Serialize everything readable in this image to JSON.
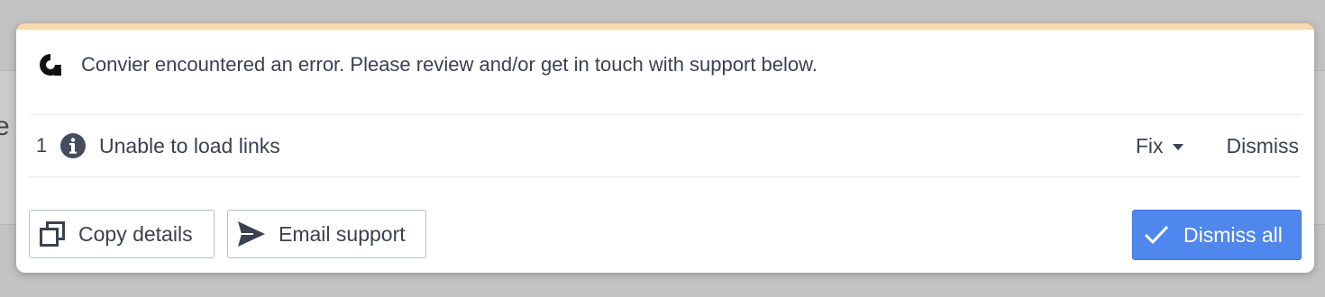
{
  "background": {
    "peek_text": "e"
  },
  "dialog": {
    "accent_color": "#fbd9ae",
    "logo_icon": "convier-logo-icon",
    "message": "Convier encountered an error. Please review and/or get in touch with support below."
  },
  "errors": [
    {
      "count": "1",
      "icon": "info-icon",
      "text": "Unable to load links",
      "fix_label": "Fix",
      "dismiss_label": "Dismiss"
    }
  ],
  "footer": {
    "copy_label": "Copy details",
    "copy_icon": "copy-icon",
    "email_label": "Email support",
    "email_icon": "send-icon",
    "dismiss_all_label": "Dismiss all",
    "dismiss_all_icon": "check-icon",
    "primary_color": "#4f87ee"
  }
}
